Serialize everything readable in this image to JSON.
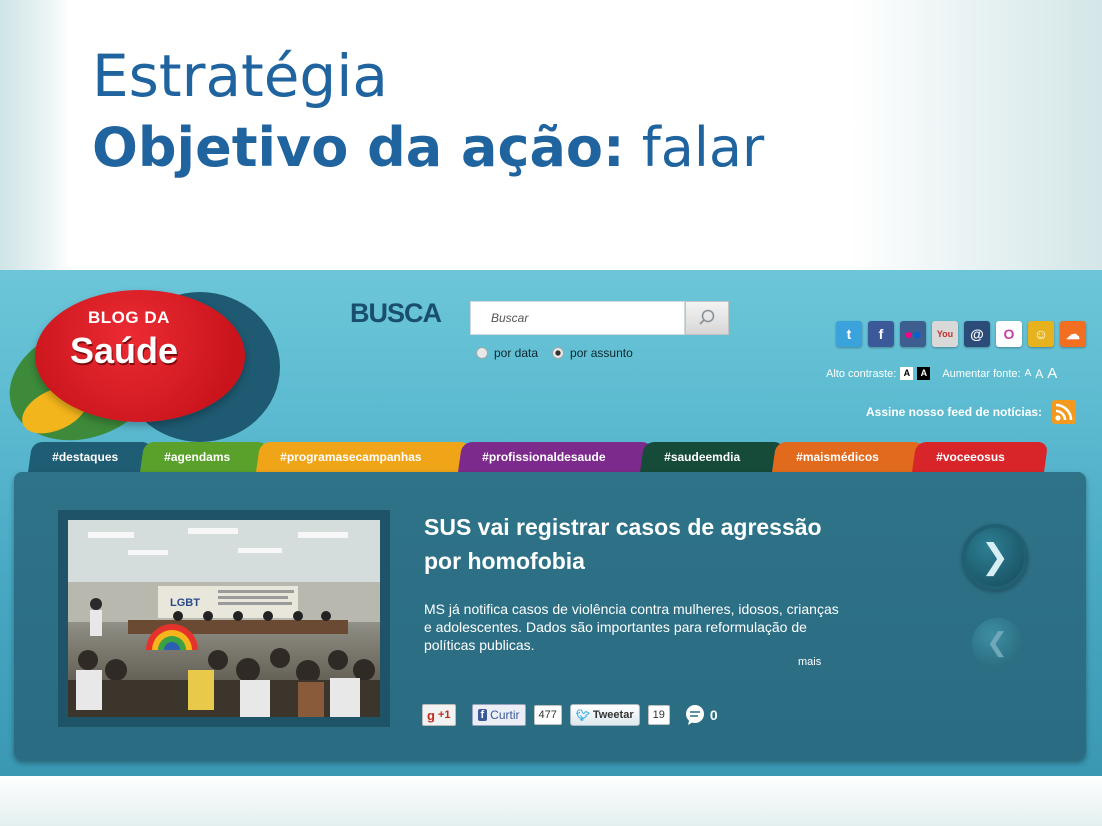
{
  "slide": {
    "title_line1": "Estratégia",
    "title_bold": "Objetivo da ação:",
    "title_rest": " falar"
  },
  "blog": {
    "logo_top": "BLOG DA",
    "logo_main": "Saúde",
    "search_label": "BUSCA",
    "search_placeholder": "Buscar",
    "radio_options": [
      "por data",
      "por assunto"
    ],
    "radio_selected": "por assunto",
    "social_icons": [
      "twitter-icon",
      "facebook-icon",
      "flickr-icon",
      "youtube-icon",
      "identica-icon",
      "orkut-icon",
      "friends-icon",
      "soundcloud-icon"
    ],
    "contrast_label": "Alto contraste:",
    "contrast_options": [
      "A",
      "A"
    ],
    "font_label": "Aumentar fonte:",
    "font_options": [
      "A",
      "A",
      "A"
    ],
    "feed_label": "Assine nosso feed de notícias:",
    "tabs": [
      {
        "label": "#destaques",
        "color": "#1f5d74"
      },
      {
        "label": "#agendams",
        "color": "#5aa12c"
      },
      {
        "label": "#programasecampanhas",
        "color": "#f0a418"
      },
      {
        "label": "#profissionaldesaude",
        "color": "#7c2b8c"
      },
      {
        "label": "#saudeemdia",
        "color": "#164a39"
      },
      {
        "label": "#maismédicos",
        "color": "#e26a1c"
      },
      {
        "label": "#voceeosus",
        "color": "#d8252a"
      }
    ],
    "article": {
      "headline": "SUS vai registrar casos de agressão por homofobia",
      "summary": "MS já notifica casos de violência contra mulheres, idosos, crianças e adolescentes. Dados são importantes para reformulação de políticas publicas.",
      "more_label": "mais",
      "photo_banner": "LGBT"
    },
    "share": {
      "gplus_label": "+1",
      "facebook_label": "Curtir",
      "facebook_count": "477",
      "twitter_label": "Tweetar",
      "twitter_count": "19",
      "comments_count": "0"
    },
    "nav": {
      "next": "❯",
      "prev": "❮"
    }
  }
}
